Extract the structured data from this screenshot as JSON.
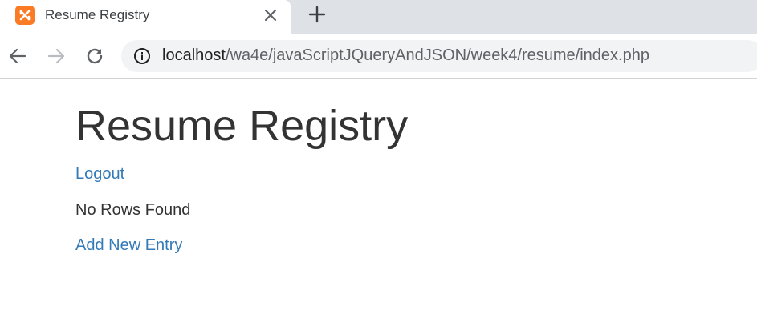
{
  "browser": {
    "tab": {
      "title": "Resume Registry",
      "favicon": "xampp-icon",
      "favicon_color": "#fb7a24"
    },
    "address_bar": {
      "host": "localhost",
      "path": "/wa4e/javaScriptJQueryAndJSON/week4/resume/index.php"
    }
  },
  "page": {
    "title": "Resume Registry",
    "logout_label": "Logout",
    "empty_message": "No Rows Found",
    "add_entry_label": "Add New Entry",
    "link_color": "#337ab7"
  }
}
